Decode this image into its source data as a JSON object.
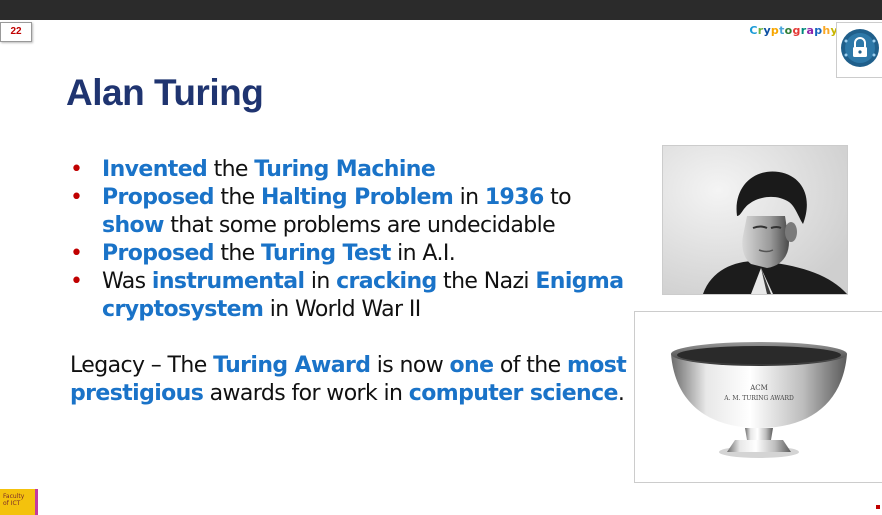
{
  "slide_number": "22",
  "course_title_chars": [
    "C",
    "r",
    "y",
    "p",
    "t",
    "o",
    "g",
    "r",
    "a",
    "p",
    "h",
    "y"
  ],
  "title": "Alan Turing",
  "bullets": [
    [
      {
        "t": "Invented",
        "hl": true
      },
      {
        "t": " the "
      },
      {
        "t": "Turing Machine",
        "hl": true
      }
    ],
    [
      {
        "t": "Proposed",
        "hl": true
      },
      {
        "t": " the "
      },
      {
        "t": "Halting Problem",
        "hl": true
      },
      {
        "t": " in "
      },
      {
        "t": "1936",
        "hl": true
      },
      {
        "t": " to "
      },
      {
        "t": "show",
        "hl": true
      },
      {
        "t": " that some problems are undecidable"
      }
    ],
    [
      {
        "t": "Proposed",
        "hl": true
      },
      {
        "t": " the "
      },
      {
        "t": "Turing Test",
        "hl": true
      },
      {
        "t": " in A.I."
      }
    ],
    [
      {
        "t": "Was "
      },
      {
        "t": "instrumental",
        "hl": true
      },
      {
        "t": " in "
      },
      {
        "t": "cracking",
        "hl": true
      },
      {
        "t": " the Nazi "
      },
      {
        "t": "Enigma cryptosystem",
        "hl": true
      },
      {
        "t": " in World War II"
      }
    ]
  ],
  "legacy": [
    {
      "t": "Legacy – The "
    },
    {
      "t": "Turing Award",
      "hl": true
    },
    {
      "t": " is now "
    },
    {
      "t": "one",
      "hl": true
    },
    {
      "t": " of the "
    },
    {
      "t": "most prestigious",
      "hl": true
    },
    {
      "t": " awards for work in "
    },
    {
      "t": "computer science",
      "hl": true
    },
    {
      "t": "."
    }
  ],
  "trophy_engraving": [
    "ACM",
    "A. M. TURING AWARD"
  ],
  "footer_logo_text": [
    "Faculty",
    "of ICT"
  ]
}
